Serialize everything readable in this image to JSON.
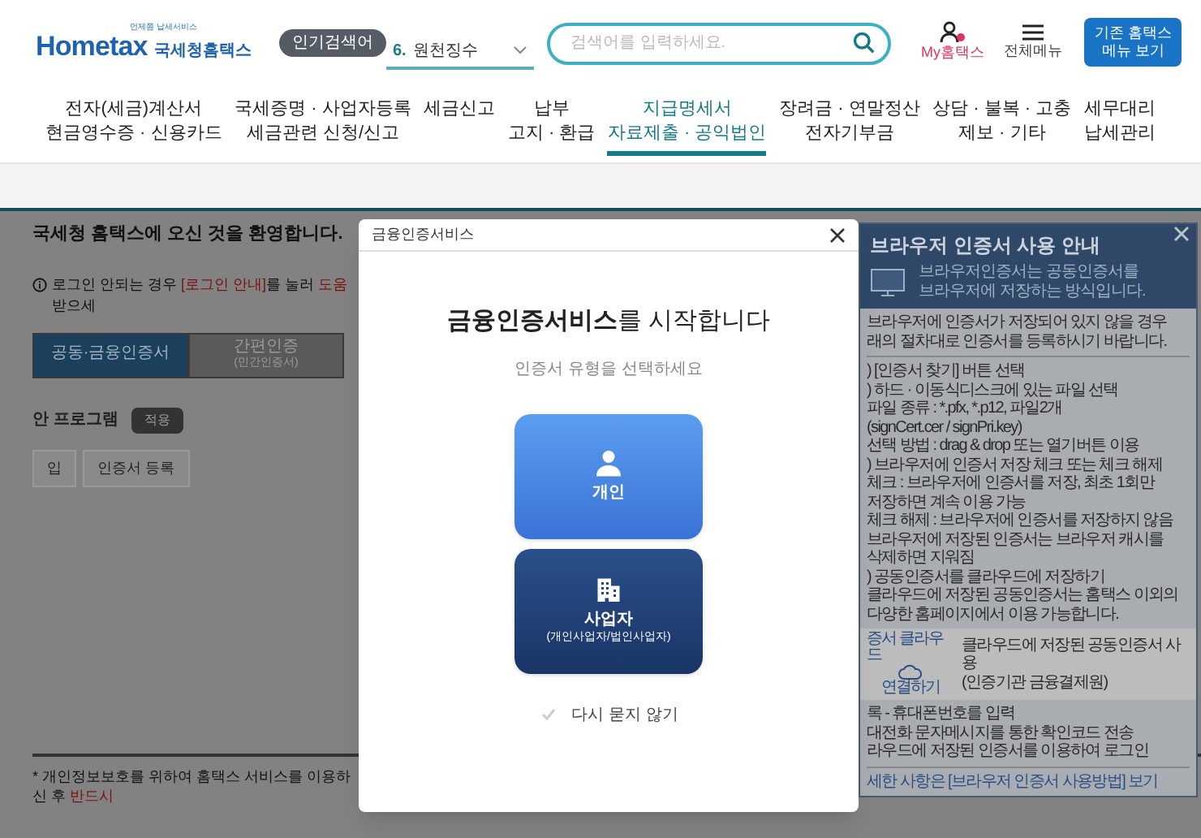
{
  "header": {
    "logo_tagline": "언제쯤 납세서비스",
    "logo_text": "Hometax",
    "logo_org": "국세청홈택스",
    "popular_badge": "인기검색어",
    "popular_rank": "6.",
    "popular_term": "원천징수",
    "search": {
      "placeholder": "검색어를 입력하세요."
    },
    "my_label": "My홈택스",
    "menu_label": "전체메뉴",
    "legacy_button": [
      "기존 홈택스",
      "메뉴 보기"
    ]
  },
  "nav": [
    {
      "lines": [
        "전자(세금)계산서",
        "현금영수증 · 신용카드"
      ],
      "selected": false
    },
    {
      "lines": [
        "국세증명 · 사업자등록",
        "세금관련 신청/신고"
      ],
      "selected": false
    },
    {
      "lines": [
        "세금신고"
      ],
      "selected": false
    },
    {
      "lines": [
        "납부",
        "고지 · 환급"
      ],
      "selected": false
    },
    {
      "lines": [
        "지급명세서",
        "자료제출 · 공익법인"
      ],
      "selected": true
    },
    {
      "lines": [
        "장려금 · 연말정산",
        "전자기부금"
      ],
      "selected": false
    },
    {
      "lines": [
        "상담 · 불복 · 고충",
        "제보 · 기타"
      ],
      "selected": false
    },
    {
      "lines": [
        "세무대리",
        "납세관리"
      ],
      "selected": false
    }
  ],
  "page": {
    "welcome": "국세청 홈택스에 오신 것을 환영합니다.",
    "login_notice": [
      {
        "text": "로그인 안되는 경우 ",
        "red": false
      },
      {
        "text": "[로그인 안내]",
        "red": true
      },
      {
        "text": "를 눌러 ",
        "red": false
      },
      {
        "text": "도움",
        "red": true
      },
      {
        "text": "받으세",
        "red": false
      }
    ],
    "tabs": [
      {
        "label": "공동·금융인증서",
        "selected": true
      },
      {
        "label": "간편인증",
        "sub": "(민간인증서)",
        "selected": false
      }
    ],
    "program_label": "안 프로그램",
    "apply_button": "적용",
    "partial_button": "입",
    "register_button": "인증서 등록",
    "footnote": [
      {
        "text": "* 개인정보보호를 위하여 홈택스 서비스를 이용하신 후 ",
        "red": false
      },
      {
        "text": "반드시",
        "red": true
      }
    ]
  },
  "guide_panel": {
    "title": "브라우저 인증서 사용 안내",
    "intro_lines": [
      "브라우저인증서는 공동인증서를",
      "브라우저에 저장하는 방식입니다."
    ],
    "note_lines": [
      "브라우저에 인증서가 저장되어 있지 않을 경우",
      "래의 절차대로 인증서를 등록하시기 바랍니다."
    ],
    "steps": [
      ") [인증서 찾기] 버튼 선택",
      ") 하드 · 이동식디스크에 있는 파일 선택",
      "파일 종류 : *.pfx, *.p12, 파일2개",
      "(signCert.cer / signPri.key)",
      "선택 방법 : drag & drop 또는 열기버튼 이용",
      ") 브라우저에 인증서 저장 체크 또는 체크 해제",
      "체크 : 브라우저에 인증서를 저장, 최초 1회만",
      "저장하면 계속 이용 가능",
      "체크 해제 : 브라우저에 인증서를 저장하지 않음",
      "브라우저에 저장된 인증서는 브라우저 캐시를",
      "삭제하면 지워짐",
      ") 공동인증서를 클라우드에 저장하기",
      "클라우드에 저장된 공동인증서는 홈택스 이외의",
      "다양한 홈페이지에서 이용 가능합니다."
    ],
    "cloud": {
      "label_top": "증서 클라우드",
      "label_bottom": "연결하기",
      "lines": [
        "클라우드에 저장된 공동인증서 사용",
        "(인증기관 금융결제원)"
      ]
    },
    "after_lines": [
      "록 - 휴대폰번호를 입력",
      "대전화 문자메시지를 통한 확인코드 전송",
      "라우드에 저장된 인증서를 이용하여 로그인"
    ],
    "footer_link": "세한 사항은 [브라우저 인증서 사용방법] 보기"
  },
  "modal": {
    "title": "금융인증서비스",
    "heading": "**금융인증서비스**를 시작합니다",
    "subtitle": "인증서 유형을 선택하세요",
    "options": [
      {
        "kind": "person",
        "label": "개인"
      },
      {
        "kind": "business",
        "label": "사업자",
        "sub": "(개인사업자/법인사업자)"
      }
    ],
    "dont_ask": {
      "label": "다시 묻지 않기",
      "checked": false
    }
  }
}
